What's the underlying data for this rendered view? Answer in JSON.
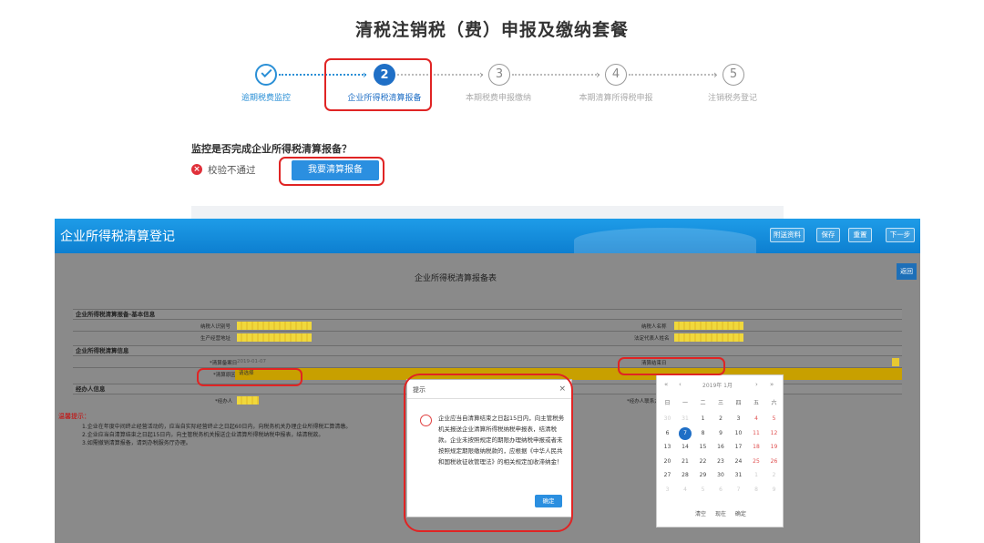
{
  "header": {
    "title": "清税注销税（费）申报及缴纳套餐"
  },
  "stepper": {
    "steps": [
      {
        "number": "",
        "label": "逾期税费监控",
        "state": "done"
      },
      {
        "number": "2",
        "label": "企业所得税清算报备",
        "state": "active"
      },
      {
        "number": "3",
        "label": "本期税费申报缴纳",
        "state": "todo"
      },
      {
        "number": "4",
        "label": "本期清算所得税申报",
        "state": "todo"
      },
      {
        "number": "5",
        "label": "注销税务登记",
        "state": "todo"
      }
    ]
  },
  "check": {
    "question": "监控是否完成企业所得税清算报备？",
    "status": "校验不通过",
    "status_icon": "error-icon",
    "button_label": "我要清算报备"
  },
  "window": {
    "title": "企业所得税清算登记",
    "buttons": [
      "附送资料",
      "保存",
      "重置",
      "下一步"
    ],
    "side_button": "返回",
    "form_title": "企业所得税清算报备表",
    "sections": {
      "basic": "企业所得税清算报备-基本信息",
      "liquidation": "企业所得税清算信息",
      "agent": "经办人信息"
    },
    "labels": {
      "taxpayer_id": "纳税人识别号",
      "taxpayer_name": "纳税人名称",
      "address": "生产经营地址",
      "legal_rep": "法定代表人姓名",
      "start_date": "*清算备案日",
      "end_date": "清算结束日",
      "reason": "*清算原因",
      "agent": "*经办人",
      "agent_contact": "*经办人联系方式"
    },
    "values": {
      "start_date": "2019-01-07",
      "reason": "请选择"
    },
    "tips_title": "温馨提示：",
    "tips": [
      "1.企业在年度中间终止经营活动的，应当自实际经营终止之日起60日内，向税务机关办理企业所得税汇算清缴。",
      "2.企业应当自清算结束之日起15日内，向主管税务机关报送企业清算所得税纳税申报表，结清税款。",
      "3.如需撤销清算报备，请到办税服务厅办理。"
    ]
  },
  "dialog": {
    "title": "提示",
    "close": "×",
    "message": "企业应当自清算结束之日起15日内，向主管税务机关报送企业清算所得税纳税申报表，结清税款。企业未按照规定的期限办理纳税申报或者未按照规定期限缴纳税款的，应根据《中华人民共和国税收征收管理法》的相关规定加收滞纳金！",
    "ok": "确定"
  },
  "datepicker": {
    "prev_year": "«",
    "prev_month": "‹",
    "title": "2019年 1月",
    "next_month": "›",
    "next_year": "»",
    "weekdays": [
      "日",
      "一",
      "二",
      "三",
      "四",
      "五",
      "六"
    ],
    "days": [
      [
        "30",
        "31",
        "1",
        "2",
        "3",
        "4",
        "5"
      ],
      [
        "6",
        "7",
        "8",
        "9",
        "10",
        "11",
        "12"
      ],
      [
        "13",
        "14",
        "15",
        "16",
        "17",
        "18",
        "19"
      ],
      [
        "20",
        "21",
        "22",
        "23",
        "24",
        "25",
        "26"
      ],
      [
        "27",
        "28",
        "29",
        "30",
        "31",
        "1",
        "2"
      ],
      [
        "3",
        "4",
        "5",
        "6",
        "7",
        "8",
        "9"
      ]
    ],
    "selected": "7",
    "footer": [
      "清空",
      "现在",
      "确定"
    ]
  },
  "colors": {
    "accent": "#1f6fc6",
    "header": "#0d7fd0",
    "highlight": "#e02424"
  }
}
